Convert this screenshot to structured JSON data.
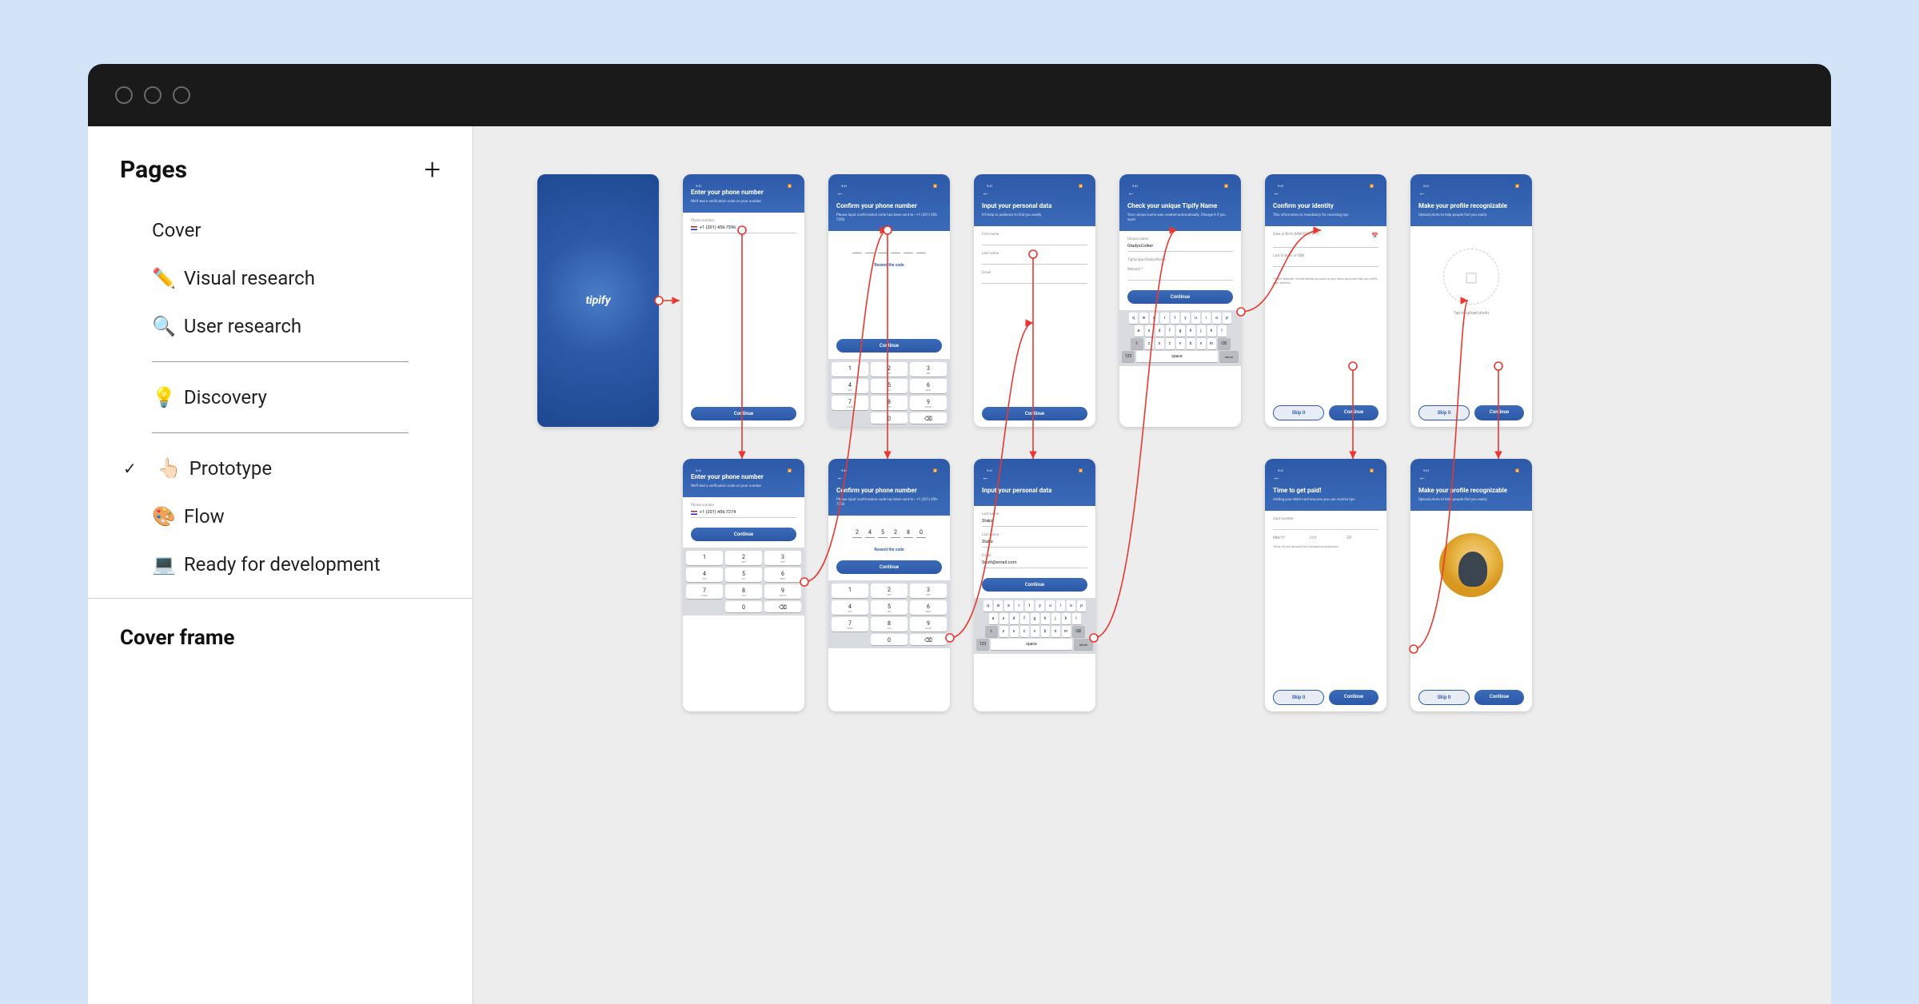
{
  "sidebar": {
    "pages_label": "Pages",
    "items": [
      {
        "label": "Cover",
        "emoji": ""
      },
      {
        "label": "Visual research",
        "emoji": "✏️"
      },
      {
        "label": "User research",
        "emoji": "🔍"
      },
      {
        "label": "Discovery",
        "emoji": "💡"
      },
      {
        "label": "Prototype",
        "emoji": "👆🏻",
        "checked": true
      },
      {
        "label": "Flow",
        "emoji": "🎨"
      },
      {
        "label": "Ready for development",
        "emoji": "💻"
      }
    ],
    "section_title": "Cover frame"
  },
  "screens": {
    "splash_logo": "tipify",
    "status_time": "9:41",
    "phone1": {
      "title": "Enter your phone number",
      "sub": "We'll text a verification code on your number",
      "field_label": "Phone number",
      "value": "+1 (201) 456-7596",
      "continue": "Continue"
    },
    "phone2": {
      "title": "Enter your phone number",
      "sub": "We'll text a verification code on your number",
      "field_label": "Phone number",
      "value": "+1 (201) 456-7274",
      "continue": "Continue"
    },
    "confirm1": {
      "title": "Confirm your phone number",
      "sub": "Please input confirmation code has been sent to • +1 (201) 456-7356",
      "resend": "Resend the code",
      "continue": "Continue"
    },
    "confirm2": {
      "title": "Confirm your phone number",
      "sub": "Please input confirmation code has been sent to • +1 (201) 456-7356",
      "code": [
        "2",
        "4",
        "5",
        "2",
        "8",
        "0"
      ],
      "resend": "Resend the code",
      "continue": "Continue"
    },
    "personal1": {
      "title": "Input your personal data",
      "sub": "It'll help to audience to find you easily",
      "fields": [
        "First name",
        "Last name",
        "Email"
      ],
      "continue": "Continue"
    },
    "personal2": {
      "title": "Input your personal data",
      "lastname_label": "Last name",
      "lastname": "Staks",
      "email_label": "Email",
      "email": "Scott@email.com",
      "continue": "Continue"
    },
    "tipify_name": {
      "title": "Check your unique Tipify Name",
      "sub": "Your unique name was created automatically. Change it if you want",
      "field_label": "Unique name",
      "value": "GladysColker",
      "hint": "Tipify/app/GladysName",
      "website_label": "Website *",
      "continue": "Continue"
    },
    "identity": {
      "title": "Confirm your identity",
      "sub": "This information is mandatory for receiving tips",
      "dob_label": "Date of Birth (MM/DD/YYYY)",
      "ssn_label": "Last 4 digits of SSN",
      "note": "*Enter Website, Social Media Account or any other account that can verify your identity",
      "skip": "Skip it",
      "continue": "Continue"
    },
    "paid": {
      "title": "Time to get paid!",
      "sub": "Adding your debit card ensures you can receive tips",
      "card_label": "Card number",
      "mmyy": "MM/YY",
      "cvv": "CVV",
      "zip": "ZIP",
      "note": "*Only US are allowed for transaction purposes",
      "skip": "Skip it",
      "continue": "Continue"
    },
    "profile1": {
      "title": "Make your profile recognizable",
      "sub": "Upload photo to help people find you easily",
      "tap": "Tap to upload photo",
      "skip": "Skip it",
      "continue": "Continue"
    },
    "profile2": {
      "title": "Make your profile recognizable",
      "sub": "Upload photo to help people find you easily",
      "skip": "Skip it",
      "continue": "Continue"
    },
    "keypad": {
      "keys": [
        {
          "n": "1",
          "s": ""
        },
        {
          "n": "2",
          "s": "ABC"
        },
        {
          "n": "3",
          "s": "DEF"
        },
        {
          "n": "4",
          "s": "GHI"
        },
        {
          "n": "5",
          "s": "JKL"
        },
        {
          "n": "6",
          "s": "MNO"
        },
        {
          "n": "7",
          "s": "PQRS"
        },
        {
          "n": "8",
          "s": "TUV"
        },
        {
          "n": "9",
          "s": "WXYZ"
        },
        {
          "n": "",
          "s": ""
        },
        {
          "n": "0",
          "s": ""
        },
        {
          "n": "⌫",
          "s": ""
        }
      ]
    },
    "qwerty": {
      "r1": [
        "q",
        "w",
        "e",
        "r",
        "t",
        "y",
        "u",
        "i",
        "o",
        "p"
      ],
      "r2": [
        "a",
        "s",
        "d",
        "f",
        "g",
        "h",
        "j",
        "k",
        "l"
      ],
      "r3": [
        "z",
        "x",
        "c",
        "v",
        "b",
        "n",
        "m"
      ],
      "space": "space",
      "return": "return",
      "num": "123"
    }
  }
}
